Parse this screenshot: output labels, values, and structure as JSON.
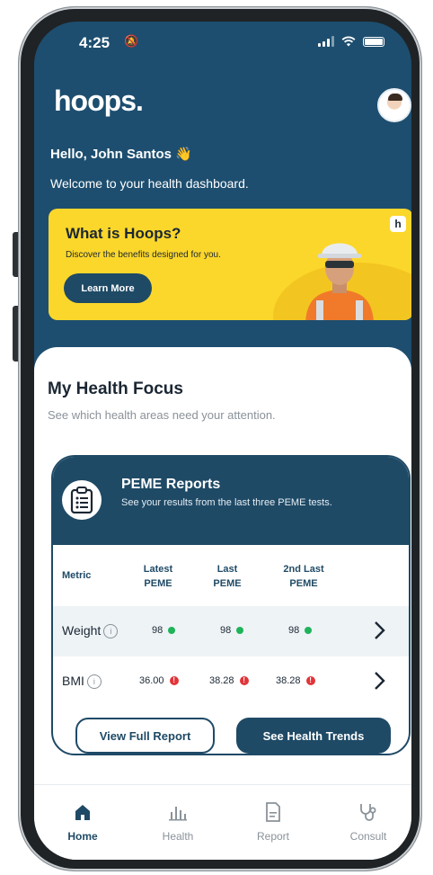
{
  "status_bar": {
    "time": "4:25"
  },
  "header": {
    "logo": "hoops.",
    "greeting": "Hello, John Santos 👋",
    "welcome": "Welcome to your health dashboard."
  },
  "promo": {
    "title": "What is Hoops?",
    "subtitle": "Discover the benefits designed for you.",
    "button": "Learn More",
    "badge": "h"
  },
  "focus": {
    "title": "My Health Focus",
    "subtitle": "See which health areas need your attention."
  },
  "peme": {
    "title": "PEME Reports",
    "subtitle": "See your results from the last three PEME tests.",
    "columns": [
      "Metric",
      "Latest PEME",
      "Last PEME",
      "2nd Last PEME"
    ],
    "rows": [
      {
        "metric": "Weight",
        "info": "i",
        "values": [
          "98",
          "98",
          "98"
        ],
        "status": "normal"
      },
      {
        "metric": "BMI",
        "info": "i",
        "values": [
          "36.00",
          "38.28",
          "38.28"
        ],
        "status": "alert"
      }
    ],
    "btn_full_report": "View Full Report",
    "btn_trends": "See Health Trends"
  },
  "tabs": [
    {
      "label": "Home",
      "icon": "home-icon",
      "active": true
    },
    {
      "label": "Health",
      "icon": "bar-chart-icon",
      "active": false
    },
    {
      "label": "Report",
      "icon": "document-icon",
      "active": false
    },
    {
      "label": "Consult",
      "icon": "stethoscope-icon",
      "active": false
    }
  ],
  "colors": {
    "primary": "#1f4a66",
    "accent": "#fcd72b",
    "ok": "#1fb35a",
    "alert": "#e0353a"
  }
}
